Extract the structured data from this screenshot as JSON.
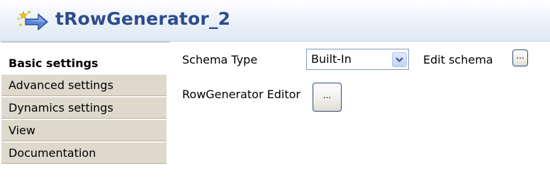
{
  "header": {
    "title": "tRowGenerator_2",
    "icon": "row-generator-icon"
  },
  "tabs": [
    {
      "label": "Basic settings",
      "active": true
    },
    {
      "label": "Advanced settings",
      "active": false
    },
    {
      "label": "Dynamics settings",
      "active": false
    },
    {
      "label": "View",
      "active": false
    },
    {
      "label": "Documentation",
      "active": false
    }
  ],
  "basic": {
    "schema_type_label": "Schema Type",
    "schema_type_value": "Built-In",
    "edit_schema_label": "Edit schema",
    "edit_schema_button": "...",
    "row_generator_editor_label": "RowGenerator Editor",
    "row_generator_editor_button": "..."
  },
  "colors": {
    "title": "#2d4c8c",
    "tab_bg": "#ddd9cc",
    "button_border": "#2e4a7d"
  }
}
